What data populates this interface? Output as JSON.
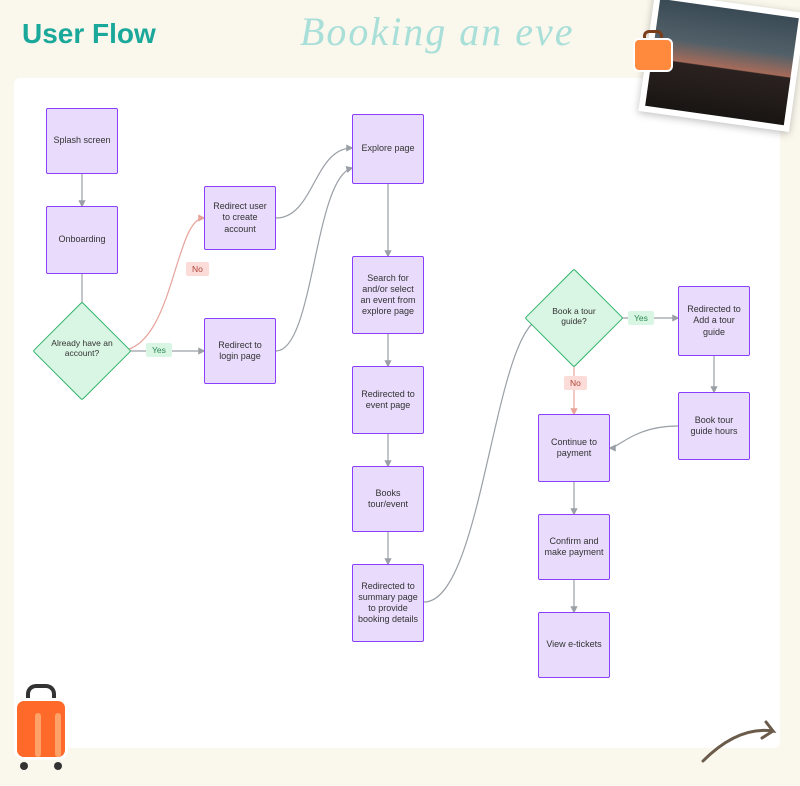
{
  "title": "User Flow",
  "subtitle": "Booking an eve",
  "nodes": {
    "splash": "Splash screen",
    "onboarding": "Onboarding",
    "already_account": "Already have an account?",
    "redirect_create": "Redirect user to create account",
    "redirect_login": "Redirect to login page",
    "explore": "Explore page",
    "search_select": "Search for and/or select an event from explore page",
    "event_page": "Redirected to event page",
    "books_tour": "Books tour/event",
    "summary": "Redirected to summary page to provide booking details",
    "book_guide": "Book a tour guide?",
    "add_guide": "Redirected to Add a tour guide",
    "guide_hours": "Book tour guide hours",
    "continue_payment": "Continue to payment",
    "confirm_payment": "Confirm and make payment",
    "view_tickets": "View e-tickets"
  },
  "labels": {
    "yes": "Yes",
    "no": "No"
  },
  "colors": {
    "accent": "#1aa89a",
    "node_border": "#8a3ffc",
    "node_fill": "#e8dbfb",
    "decision_border": "#2eb36a",
    "decision_fill": "#d9f5e3",
    "no_fill": "#fcdcd8",
    "connector": "#9aa0a6",
    "connector_no": "#e7a29a"
  }
}
